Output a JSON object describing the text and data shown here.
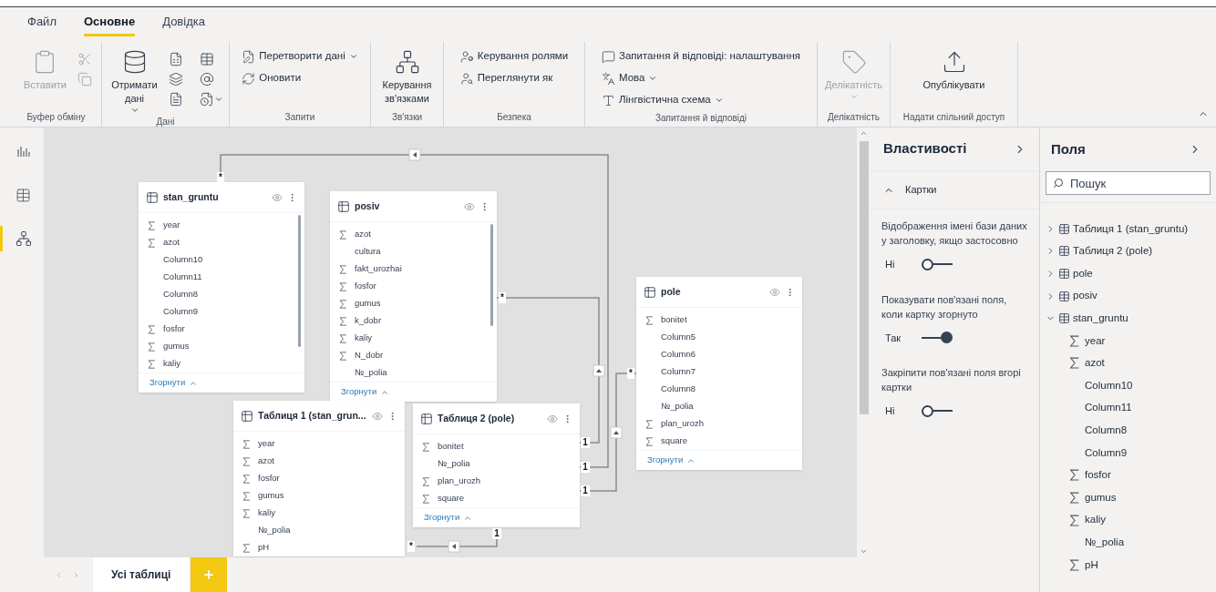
{
  "ribbon": {
    "tabs": [
      {
        "label": "Файл",
        "selected": false
      },
      {
        "label": "Основне",
        "selected": true
      },
      {
        "label": "Довідка",
        "selected": false
      }
    ],
    "groups": [
      {
        "label": "Буфер обміну",
        "items": [
          {
            "kind": "large",
            "label": "Вставити",
            "disabled": true
          },
          {
            "kind": "icon",
            "disabled": true
          },
          {
            "kind": "icon",
            "disabled": true
          }
        ]
      },
      {
        "label": "Дані",
        "items": [
          {
            "kind": "large",
            "label": "Отримати дані",
            "dropdown": true
          },
          {
            "kind": "icon"
          },
          {
            "kind": "icon"
          },
          {
            "kind": "icon"
          },
          {
            "kind": "icon"
          },
          {
            "kind": "icon"
          },
          {
            "kind": "icon",
            "dropdown": true
          }
        ]
      },
      {
        "label": "Запити",
        "items": [
          {
            "kind": "small",
            "label": "Перетворити дані",
            "dropdown": true
          },
          {
            "kind": "small",
            "label": "Оновити"
          }
        ]
      },
      {
        "label": "Зв'язки",
        "items": [
          {
            "kind": "large",
            "label": "Керування зв'язками"
          }
        ]
      },
      {
        "label": "Безпека",
        "items": [
          {
            "kind": "small",
            "label": "Керування ролями"
          },
          {
            "kind": "small",
            "label": "Переглянути як"
          }
        ]
      },
      {
        "label": "Запитання й відповіді",
        "items": [
          {
            "kind": "small",
            "label": "Запитання й відповіді: налаштування"
          },
          {
            "kind": "small",
            "label": "Мова",
            "dropdown": true
          },
          {
            "kind": "small",
            "label": "Лінгвістична схема",
            "dropdown": true
          }
        ]
      },
      {
        "label": "Делікатність",
        "items": [
          {
            "kind": "large",
            "label": "Делікатність",
            "disabled": true,
            "dropdown": true
          }
        ]
      },
      {
        "label": "Надати спільний доступ",
        "items": [
          {
            "kind": "large",
            "label": "Опублікувати"
          }
        ]
      }
    ]
  },
  "rail": [
    {
      "kind": "report",
      "selected": false
    },
    {
      "kind": "data",
      "selected": false
    },
    {
      "kind": "model",
      "selected": true
    }
  ],
  "canvas": {
    "tables": [
      {
        "name": "stan_gruntu",
        "collapse_label": "Згорнути",
        "fields": [
          {
            "name": "year",
            "sum": true
          },
          {
            "name": "azot",
            "sum": true
          },
          {
            "name": "Column10",
            "sum": false
          },
          {
            "name": "Column11",
            "sum": false
          },
          {
            "name": "Column8",
            "sum": false
          },
          {
            "name": "Column9",
            "sum": false
          },
          {
            "name": "fosfor",
            "sum": true
          },
          {
            "name": "gumus",
            "sum": true
          },
          {
            "name": "kaliy",
            "sum": true
          }
        ]
      },
      {
        "name": "posiv",
        "collapse_label": "Згорнути",
        "fields": [
          {
            "name": "azot",
            "sum": true
          },
          {
            "name": "cultura",
            "sum": false
          },
          {
            "name": "fakt_urozhai",
            "sum": true
          },
          {
            "name": "fosfor",
            "sum": true
          },
          {
            "name": "gumus",
            "sum": true
          },
          {
            "name": "k_dobr",
            "sum": true
          },
          {
            "name": "kaliy",
            "sum": true
          },
          {
            "name": "N_dobr",
            "sum": true
          },
          {
            "name": "№_polia",
            "sum": false
          }
        ]
      },
      {
        "name": "Таблиця 1 (stan_grun...",
        "fields": [
          {
            "name": "year",
            "sum": true
          },
          {
            "name": "azot",
            "sum": true
          },
          {
            "name": "fosfor",
            "sum": true
          },
          {
            "name": "gumus",
            "sum": true
          },
          {
            "name": "kaliy",
            "sum": true
          },
          {
            "name": "№_polia",
            "sum": false
          },
          {
            "name": "pH",
            "sum": true
          }
        ]
      },
      {
        "name": "Таблиця 2 (pole)",
        "collapse_label": "Згорнути",
        "fields": [
          {
            "name": "bonitet",
            "sum": true
          },
          {
            "name": "№_polia",
            "sum": false
          },
          {
            "name": "plan_urozh",
            "sum": true
          },
          {
            "name": "square",
            "sum": true
          }
        ]
      },
      {
        "name": "pole",
        "collapse_label": "Згорнути",
        "fields": [
          {
            "name": "bonitet",
            "sum": true
          },
          {
            "name": "Column5",
            "sum": false
          },
          {
            "name": "Column6",
            "sum": false
          },
          {
            "name": "Column7",
            "sum": false
          },
          {
            "name": "Column8",
            "sum": false
          },
          {
            "name": "№_polia",
            "sum": false
          },
          {
            "name": "plan_urozh",
            "sum": true
          },
          {
            "name": "square",
            "sum": true
          }
        ]
      }
    ],
    "relationships": [
      {
        "from": "*",
        "to": "1"
      },
      {
        "from": "*",
        "to": "1"
      },
      {
        "from": "1",
        "to": "*"
      },
      {
        "from": "1",
        "to": "*"
      }
    ]
  },
  "layout_tabs": [
    {
      "label": "Усі таблиці",
      "selected": true
    }
  ],
  "properties": {
    "title": "Властивості",
    "section": {
      "label": "Картки",
      "expanded": true
    },
    "settings": [
      {
        "label": "Відображення імені бази даних у заголовку, якщо застосовно",
        "value": "Ні",
        "on": false
      },
      {
        "label": "Показувати пов'язані поля, коли картку згорнуто",
        "value": "Так",
        "on": true
      },
      {
        "label": "Закріпити пов'язані поля вгорі картки",
        "value": "Ні",
        "on": false
      }
    ]
  },
  "fields": {
    "title": "Поля",
    "search": {
      "placeholder": "Пошук"
    },
    "tables": [
      {
        "name": "Таблиця 1 (stan_gruntu)",
        "expanded": false
      },
      {
        "name": "Таблиця 2 (pole)",
        "expanded": false
      },
      {
        "name": "pole",
        "expanded": false
      },
      {
        "name": "posiv",
        "expanded": false
      },
      {
        "name": "stan_gruntu",
        "expanded": true,
        "children": [
          {
            "name": "year",
            "sum": true
          },
          {
            "name": "azot",
            "sum": true
          },
          {
            "name": "Column10",
            "sum": false
          },
          {
            "name": "Column11",
            "sum": false
          },
          {
            "name": "Column8",
            "sum": false
          },
          {
            "name": "Column9",
            "sum": false
          },
          {
            "name": "fosfor",
            "sum": true
          },
          {
            "name": "gumus",
            "sum": true
          },
          {
            "name": "kaliy",
            "sum": true
          },
          {
            "name": "№_polia",
            "sum": false
          },
          {
            "name": "pH",
            "sum": true
          }
        ]
      }
    ]
  }
}
